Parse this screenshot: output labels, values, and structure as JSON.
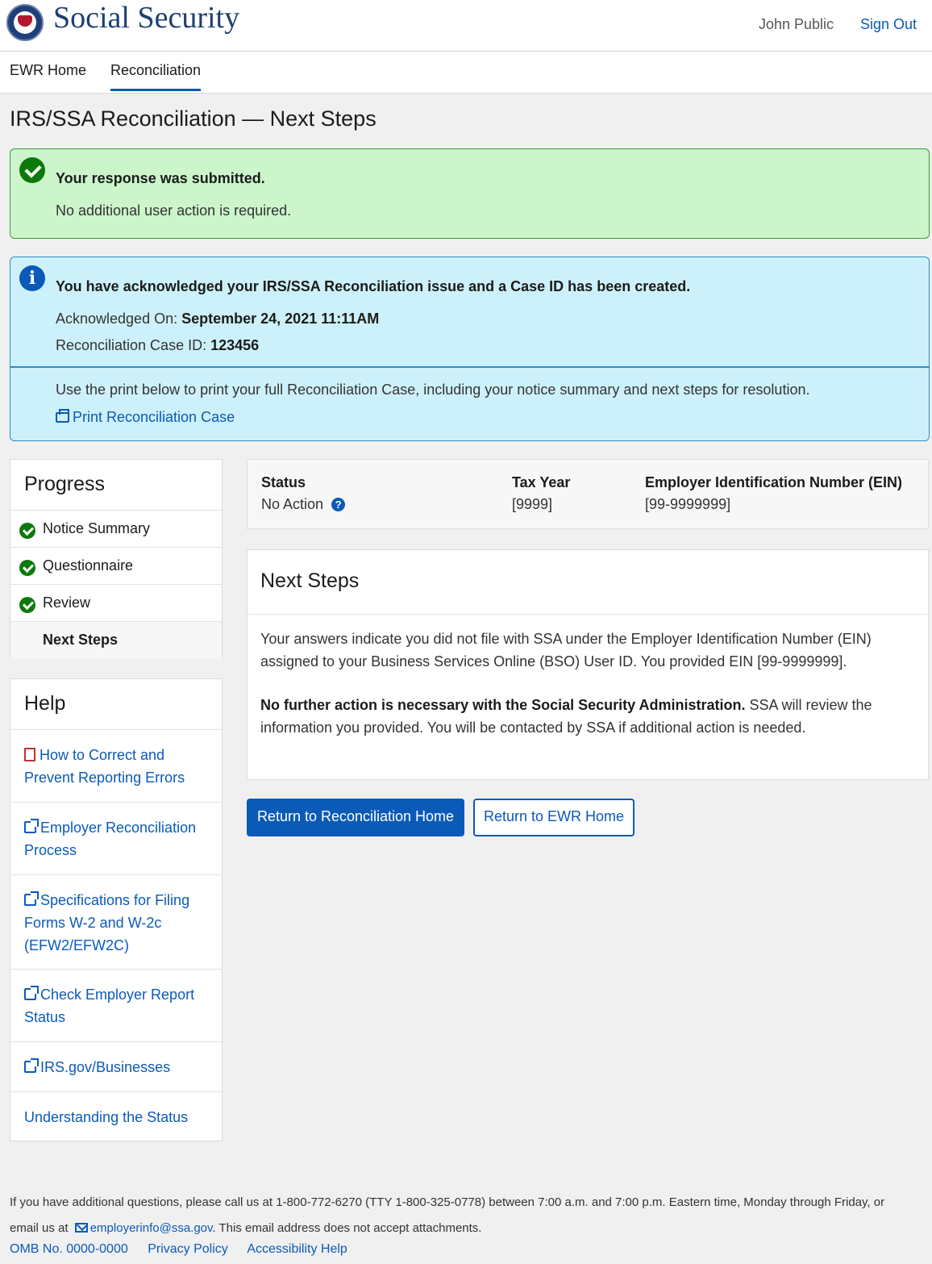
{
  "header": {
    "brand": "Social Security",
    "user_name": "John Public",
    "sign_out": "Sign Out"
  },
  "tabs": [
    {
      "label": "EWR Home",
      "active": false
    },
    {
      "label": "Reconciliation",
      "active": true
    }
  ],
  "page_title": "IRS/SSA Reconciliation — Next Steps",
  "success_alert": {
    "title": "Your response was submitted.",
    "message": "No additional user action is required."
  },
  "info_alert": {
    "title": "You have acknowledged your IRS/SSA Reconciliation issue and a Case ID has been created.",
    "acknowledged_label": "Acknowledged On:",
    "acknowledged_value": "September 24, 2021 11:11AM",
    "case_id_label": "Reconciliation Case ID:",
    "case_id_value": "123456",
    "instructions": "Use the print below to print your full Reconciliation Case, including your notice summary and next steps for resolution.",
    "print_link": "Print Reconciliation Case"
  },
  "progress": {
    "title": "Progress",
    "items": [
      {
        "label": "Notice Summary",
        "complete": true
      },
      {
        "label": "Questionnaire",
        "complete": true
      },
      {
        "label": "Review",
        "complete": true
      },
      {
        "label": "Next Steps",
        "complete": false,
        "current": true
      }
    ]
  },
  "help": {
    "title": "Help",
    "links": [
      {
        "label": "How to Correct and Prevent Reporting Errors",
        "icon": "pdf-icon"
      },
      {
        "label": "Employer Reconciliation Process",
        "icon": "external-link-icon"
      },
      {
        "label": "Specifications for Filing Forms W-2 and W-2c (EFW2/EFW2C)",
        "icon": "external-link-icon"
      },
      {
        "label": "Check Employer Report Status",
        "icon": "external-link-icon"
      },
      {
        "label": "IRS.gov/Businesses",
        "icon": "external-link-icon"
      },
      {
        "label": "Understanding the Status",
        "icon": ""
      }
    ]
  },
  "status_bar": {
    "status_label": "Status",
    "status_value": "No Action",
    "tax_year_label": "Tax Year",
    "tax_year_value": "[9999]",
    "ein_label": "Employer Identification Number (EIN)",
    "ein_value": "[99-9999999]"
  },
  "next_steps": {
    "title": "Next Steps",
    "paragraph1": "Your answers indicate you did not file with SSA under the Employer Identification Number (EIN) assigned to your Business Services Online (BSO) User ID. You provided EIN [99-9999999].",
    "paragraph2_bold": "No further action is necessary with the Social Security Administration.",
    "paragraph2_rest": " SSA will review the information you provided. You will be contacted by SSA if additional action is needed."
  },
  "buttons": {
    "primary": "Return to Reconciliation Home",
    "secondary": "Return to EWR Home"
  },
  "footer": {
    "contact_text_1": "If you have additional questions, please call us at 1-800-772-6270 (TTY 1-800-325-0778) between 7:00 a.m. and 7:00 p.m. Eastern time, Monday through Friday, or email us at",
    "email": "employerinfo@ssa.gov",
    "contact_text_2": ". This email address does not accept attachments.",
    "links": [
      "OMB No. 0000-0000",
      "Privacy Policy",
      "Accessibility Help"
    ]
  },
  "colors": {
    "link_blue": "#0b5ab8",
    "success_bg": "#ccf5cc",
    "info_bg": "#cdf1fa",
    "success_green": "#0b7a0b"
  }
}
